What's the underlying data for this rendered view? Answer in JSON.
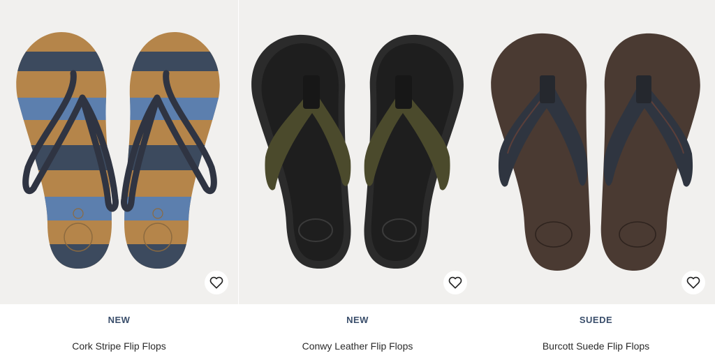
{
  "products": [
    {
      "badge": "NEW",
      "title": "Cork Stripe Flip Flops",
      "background": "#f1f0ee",
      "sole_colors": [
        "#b5854a",
        "#3c4a5e",
        "#5c7fae"
      ],
      "strap_color": "#2f3442",
      "sole_marking": "40",
      "favorite_icon": "heart-outline-icon"
    },
    {
      "badge": "NEW",
      "title": "Conwy Leather Flip Flops",
      "background": "#f1f0ee",
      "sole_colors": [
        "#2b2b2b",
        "#1b1b1b"
      ],
      "strap_color": "#4b4a2c",
      "favorite_icon": "heart-outline-icon"
    },
    {
      "badge": "SUEDE",
      "title": "Burcott Suede Flip Flops",
      "background": "#f1f0ee",
      "sole_colors": [
        "#4a3a32",
        "#3a2d27"
      ],
      "strap_color": "#2f3540",
      "favorite_icon": "heart-outline-icon"
    }
  ]
}
